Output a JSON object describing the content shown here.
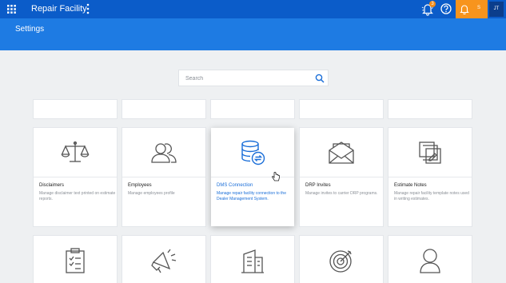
{
  "topbar": {
    "app_title": "Repair Facility",
    "bell_badge": "3",
    "notif_label": "S",
    "avatar_initials": "JT"
  },
  "header": {
    "title": "Settings"
  },
  "search": {
    "placeholder": "Search"
  },
  "cards": [
    {
      "title": "Disclaimers",
      "description": "Manage disclaimer text printed on estimate reports.",
      "icon": "scales-icon"
    },
    {
      "title": "Employees",
      "description": "Manage employees profile",
      "icon": "people-icon"
    },
    {
      "title": "DMS Connection",
      "description": "Manage repair facility connection to the Dealer Management System.",
      "icon": "database-sync-icon"
    },
    {
      "title": "DRP Invites",
      "description": "Manage invites to carrier DRP programs.",
      "icon": "envelope-icon"
    },
    {
      "title": "Estimate Notes",
      "description": "Manage repair facility template notes used in writing estimates.",
      "icon": "notes-icon"
    }
  ],
  "bottom_row_icons": [
    "clipboard-checklist-icon",
    "megaphone-icon",
    "building-icon",
    "target-icon",
    "person-icon"
  ]
}
